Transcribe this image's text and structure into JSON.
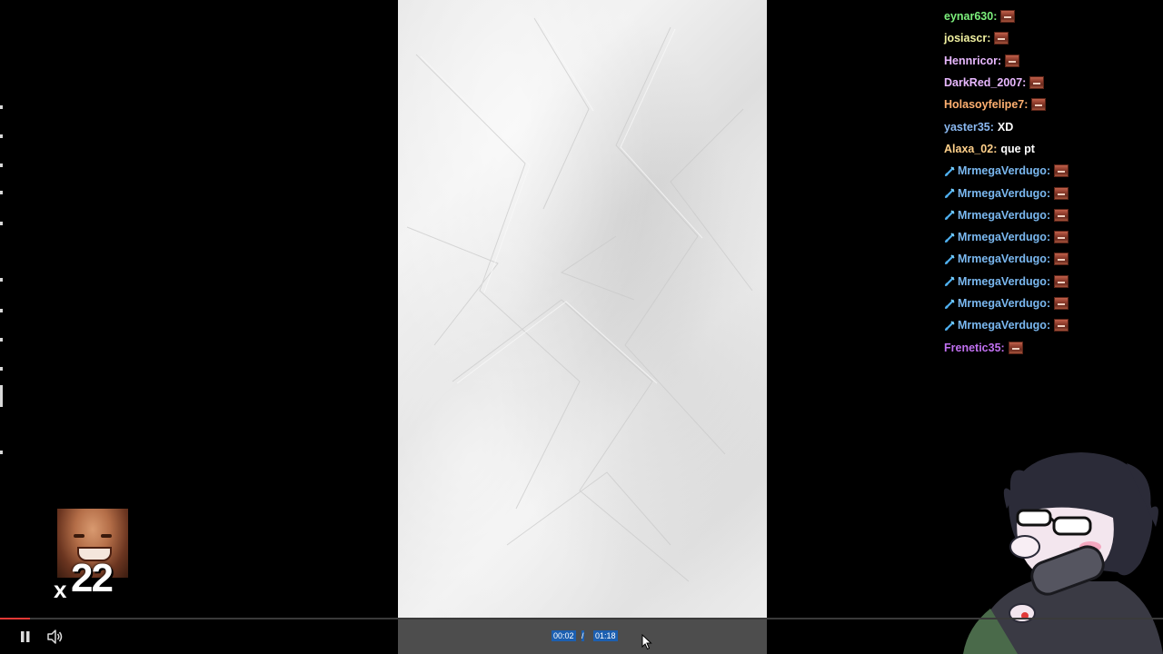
{
  "chat": {
    "messages": [
      {
        "user": "eynar630",
        "color": "#7cf07c",
        "sep": ":",
        "text": "",
        "emote": "pog-emote",
        "badge": ""
      },
      {
        "user": "josiascr",
        "color": "#f0f0a0",
        "sep": ":",
        "text": "",
        "emote": "pog-emote",
        "badge": ""
      },
      {
        "user": "Hennricor",
        "color": "#e8b8ff",
        "sep": ":",
        "text": "",
        "emote": "pog-emote",
        "badge": ""
      },
      {
        "user": "DarkRed_2007",
        "color": "#e8b8ff",
        "sep": ":",
        "text": "",
        "emote": "pog-emote",
        "badge": ""
      },
      {
        "user": "Holasoyfelipe7",
        "color": "#ffb070",
        "sep": ":",
        "text": "",
        "emote": "pog-emote",
        "badge": ""
      },
      {
        "user": "yaster35",
        "color": "#8ab8f0",
        "sep": ":",
        "text": "XD",
        "emote": "",
        "badge": ""
      },
      {
        "user": "Alaxa_02",
        "color": "#ffd08a",
        "sep": ":",
        "text": "que pt",
        "emote": "",
        "badge": ""
      },
      {
        "user": "MrmegaVerdugo",
        "color": "#7ab8f0",
        "sep": ":",
        "text": "",
        "emote": "pog-emote",
        "badge": "sword-icon"
      },
      {
        "user": "MrmegaVerdugo",
        "color": "#7ab8f0",
        "sep": ":",
        "text": "",
        "emote": "pog-emote",
        "badge": "sword-icon"
      },
      {
        "user": "MrmegaVerdugo",
        "color": "#7ab8f0",
        "sep": ":",
        "text": "",
        "emote": "pog-emote",
        "badge": "sword-icon"
      },
      {
        "user": "MrmegaVerdugo",
        "color": "#7ab8f0",
        "sep": ":",
        "text": "",
        "emote": "pog-emote",
        "badge": "sword-icon"
      },
      {
        "user": "MrmegaVerdugo",
        "color": "#7ab8f0",
        "sep": ":",
        "text": "",
        "emote": "pog-emote",
        "badge": "sword-icon"
      },
      {
        "user": "MrmegaVerdugo",
        "color": "#7ab8f0",
        "sep": ":",
        "text": "",
        "emote": "pog-emote",
        "badge": "sword-icon"
      },
      {
        "user": "MrmegaVerdugo",
        "color": "#7ab8f0",
        "sep": ":",
        "text": "",
        "emote": "pog-emote",
        "badge": "sword-icon"
      },
      {
        "user": "MrmegaVerdugo",
        "color": "#7ab8f0",
        "sep": ":",
        "text": "",
        "emote": "pog-emote",
        "badge": "sword-icon"
      },
      {
        "user": "Frenetic35",
        "color": "#c070f0",
        "sep": ":",
        "text": "",
        "emote": "pog-emote",
        "badge": ""
      }
    ]
  },
  "combo": {
    "prefix": "x",
    "count": "22",
    "emote": "laughing-face-emote"
  },
  "player": {
    "current_time": "00:02",
    "separator": "/",
    "duration": "01:18",
    "progress_fraction": 0.026,
    "play_state_icon": "pause-icon",
    "volume_icon": "volume-icon",
    "accent_color": "#e53935"
  },
  "video": {
    "content": "crumpled-paper-texture"
  },
  "overlay": {
    "avatar": "cartoon-avatar-sunglasses"
  }
}
